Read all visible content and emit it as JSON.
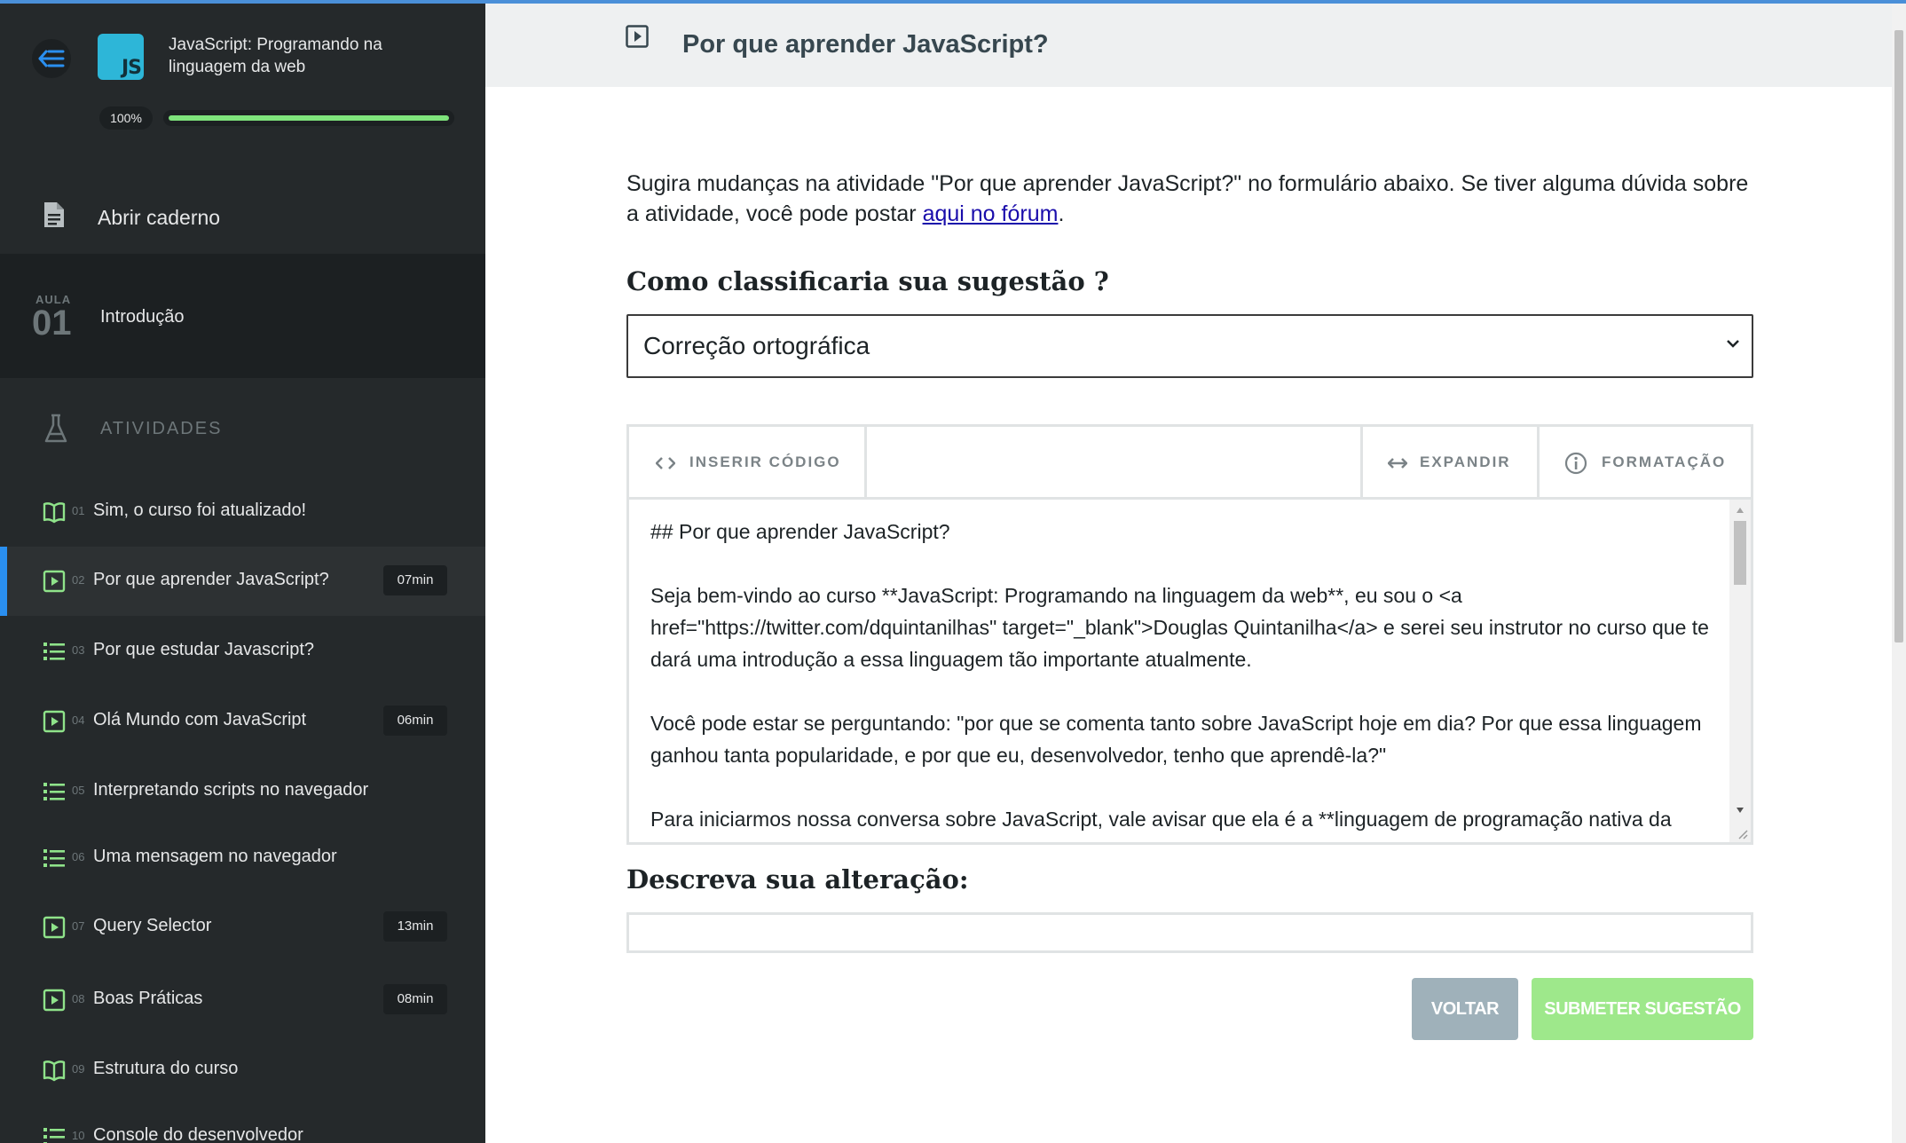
{
  "course": {
    "title": "JavaScript: Programando na linguagem da web",
    "progress_label": "100%",
    "progress": 1.0,
    "logo_text": "JS"
  },
  "sidebar": {
    "notebook_label": "Abrir caderno",
    "lesson": {
      "label": "AULA",
      "number": "01",
      "name": "Introdução"
    },
    "activities_label": "ATIVIDADES",
    "activities": [
      {
        "num": "01",
        "title": "Sim, o curso foi atualizado!",
        "icon": "book-icon",
        "duration": ""
      },
      {
        "num": "02",
        "title": "Por que aprender JavaScript?",
        "icon": "video-icon",
        "duration": "07min",
        "active": true
      },
      {
        "num": "03",
        "title": "Por que estudar Javascript?",
        "icon": "list-icon",
        "duration": ""
      },
      {
        "num": "04",
        "title": "Olá Mundo com JavaScript",
        "icon": "video-icon",
        "duration": "06min"
      },
      {
        "num": "05",
        "title": "Interpretando scripts no navegador",
        "icon": "list-icon",
        "duration": ""
      },
      {
        "num": "06",
        "title": "Uma mensagem no navegador",
        "icon": "list-icon",
        "duration": ""
      },
      {
        "num": "07",
        "title": "Query Selector",
        "icon": "video-icon",
        "duration": "13min"
      },
      {
        "num": "08",
        "title": "Boas Práticas",
        "icon": "video-icon",
        "duration": "08min"
      },
      {
        "num": "09",
        "title": "Estrutura do curso",
        "icon": "book-icon",
        "duration": ""
      },
      {
        "num": "10",
        "title": "Console do desenvolvedor",
        "icon": "list-icon",
        "duration": ""
      }
    ]
  },
  "main": {
    "title": "Por que aprender JavaScript?",
    "intro_before": "Sugira mudanças na atividade \"Por que aprender JavaScript?\" no formulário abaixo. Se tiver alguma dúvida sobre a atividade, você pode postar ",
    "intro_link": "aqui no fórum",
    "intro_after": ".",
    "classify_heading": "Como classificaria sua sugestão ?",
    "classify_value": "Correção ortográfica",
    "toolbar": {
      "insert_code": "INSERIR CÓDIGO",
      "expand": "EXPANDIR",
      "formatting": "FORMATAÇÃO"
    },
    "editor_paragraphs": [
      "## Por que aprender JavaScript?",
      "Seja bem-vindo ao curso **JavaScript: Programando na linguagem da web**, eu sou o <a href=\"https://twitter.com/dquintanilhas\" target=\"_blank\">Douglas Quintanilha</a> e serei seu instrutor no curso que te dará uma introdução a essa linguagem tão importante atualmente.",
      "Você pode estar se perguntando: \"por que se comenta tanto sobre JavaScript hoje em dia? Por que essa linguagem ganhou tanta popularidade, e por que eu, desenvolvedor, tenho que aprendê-la?\"",
      "Para iniciarmos nossa conversa sobre JavaScript, vale avisar que ela é a **linguagem de programação nativa da"
    ],
    "describe_heading": "Descreva sua alteração:",
    "describe_value": "",
    "back_label": "VOLTAR",
    "submit_label": "SUBMETER SUGESTÃO"
  },
  "colors": {
    "sidebar_bg": "#25292b",
    "accent_blue": "#2a8ff0",
    "progress_green": "#7ee27b",
    "icon_green": "#8fe38a",
    "submit_green": "#9ee88b",
    "back_gray": "#9fb1ba"
  }
}
